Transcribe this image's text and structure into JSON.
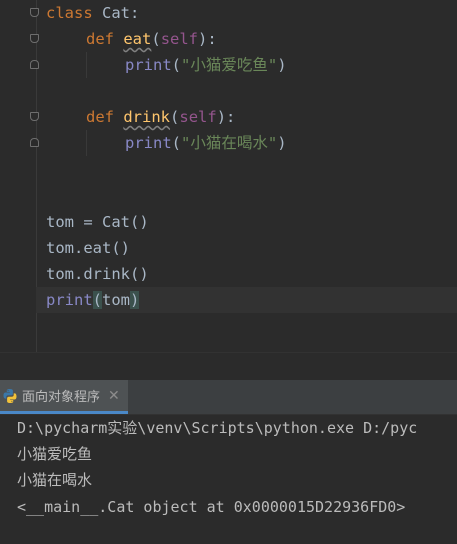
{
  "editor": {
    "lines": [
      {
        "kw": "class",
        "rest": " Cat:"
      },
      {
        "kw": "def",
        "fn": "eat",
        "open": "(",
        "self": "self",
        "close": "):"
      },
      {
        "builtin": "print",
        "open": "(",
        "str": "\"小猫爱吃鱼\"",
        "close": ")"
      },
      {
        "kw": "def",
        "fn": "drink",
        "open": "(",
        "self": "self",
        "close": "):"
      },
      {
        "builtin": "print",
        "open": "(",
        "str": "\"小猫在喝水\"",
        "close": ")"
      },
      {
        "text": "tom = Cat()"
      },
      {
        "text": "tom.eat()"
      },
      {
        "text": "tom.drink()"
      },
      {
        "builtin": "print",
        "lparen": "(",
        "arg": "tom",
        "rparen": ")"
      }
    ]
  },
  "run_panel": {
    "tab_label": "面向对象程序",
    "close_glyph": "✕",
    "icon": "python-icon"
  },
  "console": {
    "lines": [
      "D:\\pycharm实验\\venv\\Scripts\\python.exe D:/pyc",
      "小猫爱吃鱼",
      "小猫在喝水",
      "<__main__.Cat object at 0x0000015D22936FD0>"
    ]
  },
  "colors": {
    "background": "#2b2b2b",
    "keyword": "#cc7832",
    "function": "#ffc66d",
    "self": "#94558d",
    "string": "#6a8759",
    "builtin": "#8888c6",
    "text": "#a9b7c6"
  }
}
